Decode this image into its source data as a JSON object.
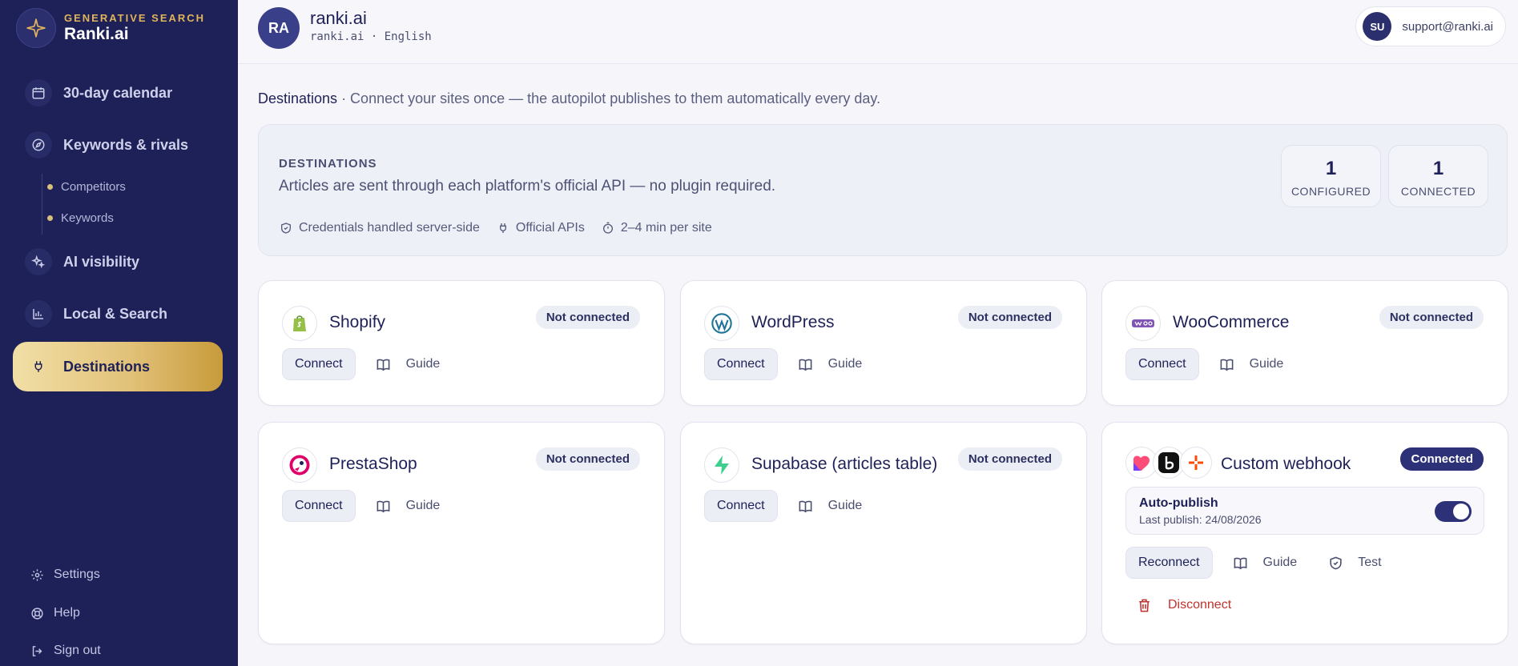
{
  "brand": {
    "kicker": "GENERATIVE SEARCH",
    "name": "Ranki.ai"
  },
  "sidebar": {
    "items": [
      {
        "label": "30-day calendar",
        "icon": "calendar-icon"
      },
      {
        "label": "Keywords & rivals",
        "icon": "compass-icon"
      },
      {
        "label": "AI visibility",
        "icon": "sparkles-icon"
      },
      {
        "label": "Local & Search",
        "icon": "bar-chart-icon"
      },
      {
        "label": "Destinations",
        "icon": "plug-icon",
        "active": true
      }
    ],
    "subitems": [
      {
        "label": "Competitors"
      },
      {
        "label": "Keywords"
      }
    ],
    "footer": [
      {
        "label": "Settings",
        "icon": "gear-icon"
      },
      {
        "label": "Help",
        "icon": "lifebuoy-icon"
      },
      {
        "label": "Sign out",
        "icon": "sign-out-icon"
      }
    ]
  },
  "topbar": {
    "avatar": "RA",
    "site_name": "ranki.ai",
    "site_sub": "ranki.ai · English",
    "user_avatar": "SU",
    "user_email": "support@ranki.ai"
  },
  "intro": {
    "title": "Destinations",
    "text": " · Connect your sites once — the autopilot publishes to them automatically every day."
  },
  "summary": {
    "title": "DESTINATIONS",
    "desc": "Articles are sent through each platform's official API — no plugin required.",
    "tags": [
      {
        "label": "Credentials handled server-side",
        "icon": "shield-icon"
      },
      {
        "label": "Official APIs",
        "icon": "plug-icon"
      },
      {
        "label": "2–4 min per site",
        "icon": "stopwatch-icon"
      }
    ],
    "stats": [
      {
        "value": "1",
        "caption": "CONFIGURED"
      },
      {
        "value": "1",
        "caption": "CONNECTED"
      }
    ]
  },
  "cards": [
    {
      "name": "Shopify",
      "status": "Not connected",
      "connect": "Connect",
      "guide": "Guide",
      "icon": "shopify-icon",
      "color": "#5e8e3e"
    },
    {
      "name": "WordPress",
      "status": "Not connected",
      "connect": "Connect",
      "guide": "Guide",
      "icon": "wordpress-icon",
      "color": "#21759b"
    },
    {
      "name": "WooCommerce",
      "status": "Not connected",
      "connect": "Connect",
      "guide": "Guide",
      "icon": "woocommerce-icon",
      "color": "#7f54b3"
    },
    {
      "name": "PrestaShop",
      "status": "Not connected",
      "connect": "Connect",
      "guide": "Guide",
      "icon": "prestashop-icon",
      "color": "#df0067"
    },
    {
      "name": "Supabase (articles table)",
      "status": "Not connected",
      "connect": "Connect",
      "guide": "Guide",
      "icon": "supabase-icon",
      "color": "#3ecf8e"
    }
  ],
  "webhook": {
    "name": "Custom webhook",
    "status": "Connected",
    "autopublish_label": "Auto-publish",
    "last_publish": "Last publish: 24/08/2026",
    "autopublish_on": true,
    "reconnect": "Reconnect",
    "guide": "Guide",
    "test": "Test",
    "disconnect": "Disconnect",
    "logos": [
      "make-icon",
      "bubble-icon",
      "zapier-icon"
    ]
  }
}
